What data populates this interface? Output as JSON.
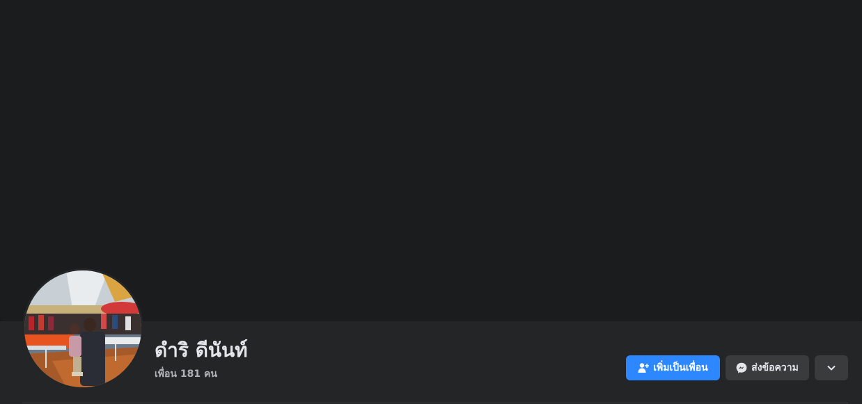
{
  "profile": {
    "name": "ดำริ ดีนันท์",
    "friends_count": "เพื่อน 181 คน",
    "avatar_icon": "profile-photo"
  },
  "actions": {
    "add_friend_label": "เพิ่มเป็นเพื่อน",
    "add_friend_icon": "add-friend-icon",
    "message_label": "ส่งข้อความ",
    "message_icon": "messenger-icon",
    "more_icon": "chevron-down-icon"
  },
  "colors": {
    "background": "#18191a",
    "cover": "#1b1c1e",
    "bar": "#242526",
    "primary": "#2d88ff",
    "secondary_button": "#3a3b3c",
    "text_primary": "#e4e6eb",
    "text_secondary": "#b0b3b8"
  }
}
